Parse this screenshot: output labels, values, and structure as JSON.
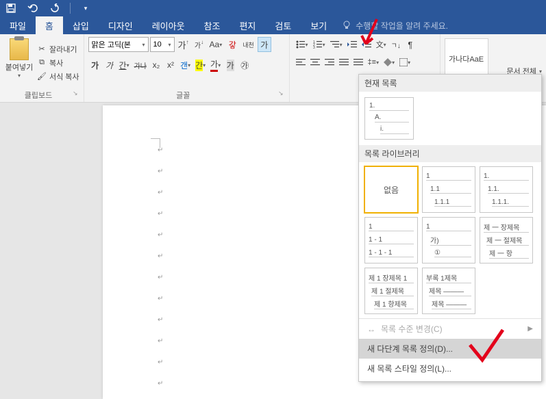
{
  "titlebar": {
    "save_icon": "save-icon",
    "undo_icon": "undo-icon",
    "redo_icon": "redo-icon"
  },
  "tabs": {
    "file": "파일",
    "home": "홈",
    "insert": "삽입",
    "design": "디자인",
    "layout": "레이아웃",
    "references": "참조",
    "mailings": "편지",
    "review": "검토",
    "view": "보기",
    "tellme": "수행할 작업을 알려 주세요."
  },
  "ribbon": {
    "clipboard": {
      "paste": "붙여넣기",
      "cut": "잘라내기",
      "copy": "복사",
      "format_painter": "서식 복사",
      "label": "클립보드"
    },
    "font": {
      "name": "맑은 고딕(본",
      "size": "10",
      "grow": "가",
      "shrink": "가",
      "case": "Aa",
      "clear": "갛",
      "phonetic": "내천",
      "charborder": "가",
      "bold": "가",
      "italic": "가",
      "underline": "간",
      "strike": "가나",
      "sub": "x₂",
      "sup": "x²",
      "effects": "갠",
      "highlight": "간",
      "color": "가",
      "circled": "㉮",
      "label": "글꼴"
    },
    "style": {
      "preview": "가나다AaE",
      "doc_all": "문서 전체"
    }
  },
  "dropdown": {
    "current_header": "현재 목록",
    "current": {
      "l1": "1.",
      "l2": "A.",
      "l3": "i."
    },
    "library_header": "목록 라이브러리",
    "items": [
      {
        "type": "none",
        "label": "없음"
      },
      {
        "l1": "1",
        "l2": "1.1",
        "l3": "1.1.1"
      },
      {
        "l1": "1.",
        "l2": "1.1.",
        "l3": "1.1.1."
      },
      {
        "l1": "1",
        "l2": "1 - 1",
        "l3": "1 - 1 - 1"
      },
      {
        "l1": "1",
        "l2": "가)",
        "l3": "①"
      },
      {
        "l1": "제 一 장제목",
        "l2": "제 一 절제목",
        "l3": "제 一 항"
      },
      {
        "l1": "제 1 장제목 1",
        "l2": "제 1 절제목",
        "l3": "제 1 항제목"
      },
      {
        "l1": "부록 1제목",
        "l2": "제목 ———",
        "l3": "제목 ———"
      }
    ],
    "change_level": "목록 수준 변경(C)",
    "define_new": "새 다단계 목록 정의(D)...",
    "define_style": "새 목록 스타일 정의(L)..."
  }
}
